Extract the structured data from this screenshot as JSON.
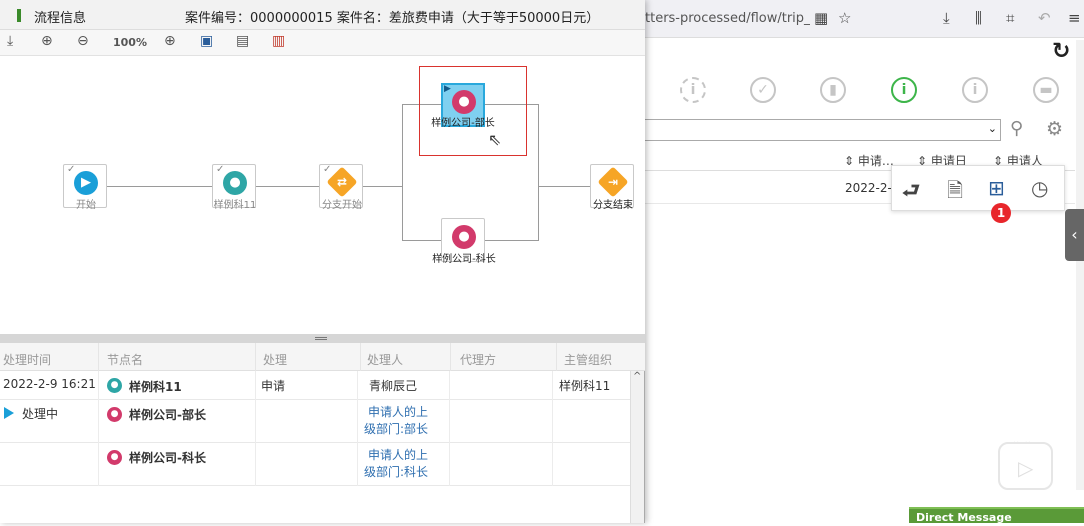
{
  "browser": {
    "url": "tters-processed/flow/trip_sc",
    "toolbar_icons": [
      "qr-icon",
      "star-icon",
      "download-icon",
      "library-icon",
      "crop-icon",
      "back-icon",
      "menu-icon"
    ],
    "table_headers": [
      "申请…",
      "申请日",
      "申请人"
    ],
    "row_date": "2022-2-9",
    "badge_count": "1",
    "dm_label": "Direct Message",
    "accent_green": "#3db54a",
    "badge_color": "#e8262b"
  },
  "dialog": {
    "title": "流程信息",
    "case_info": "案件编号：0000000015 案件名：差旅费申请（大于等于50000日元）",
    "zoom": "100%",
    "nodes": {
      "start": "开始",
      "sample11": "样例科11",
      "branch_start": "分支开始",
      "dept_head": "样例公司-部长",
      "section_head": "样例公司-科长",
      "branch_end": "分支结束"
    },
    "grid": {
      "headers": [
        "处理时间",
        "节点名",
        "处理",
        "处理人",
        "代理方",
        "主管组织"
      ],
      "rows": [
        {
          "time": "2022-2-9 16:21",
          "node": "样例科11",
          "action": "申请",
          "handler": "青柳辰己",
          "proxy": "",
          "org": "样例科11"
        },
        {
          "time": "处理中",
          "node": "样例公司-部长",
          "action": "",
          "handler": "申请人的上级部门:部长",
          "handler_l1": "申请人的上",
          "handler_l2": "级部门:部长",
          "proxy": "",
          "org": ""
        },
        {
          "time": "",
          "node": "样例公司-科长",
          "action": "",
          "handler": "申请人的上级部门:科长",
          "handler_l1": "申请人的上",
          "handler_l2": "级部门:科长",
          "proxy": "",
          "org": ""
        }
      ]
    },
    "colors": {
      "node_blue": "#1a9fd8",
      "node_teal": "#2ea6a6",
      "node_pink": "#d23a6b",
      "node_orange": "#f6a526",
      "highlight_red": "#d9332e"
    }
  }
}
